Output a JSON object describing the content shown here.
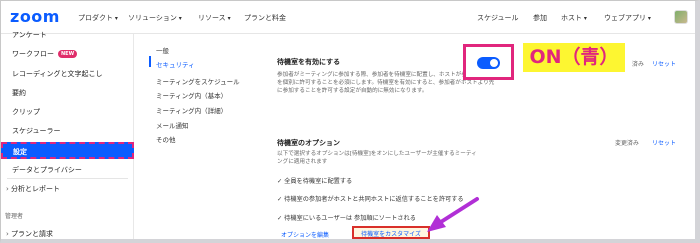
{
  "brand": {
    "logo_text": "zoom",
    "accent": "#0b5cff",
    "annotation_pink": "#e1267d",
    "annotation_yellow": "#fdf631"
  },
  "topnav": {
    "left_items": [
      "プロダクト",
      "ソリューション",
      "リソース",
      "プランと料金"
    ],
    "right_items": [
      "スケジュール",
      "参加",
      "ホスト",
      "ウェブアプリ"
    ]
  },
  "sidebar": {
    "items": [
      {
        "label": "アンケート"
      },
      {
        "label": "ワークフロー",
        "badge": "NEW"
      },
      {
        "label": "レコーディングと文字起こし"
      },
      {
        "label": "要約"
      },
      {
        "label": "クリップ"
      },
      {
        "label": "スケジューラー"
      },
      {
        "label": "設定",
        "active": true
      },
      {
        "label": "データとプライバシー"
      },
      {
        "label": "分析とレポート"
      },
      {
        "label": "管理者"
      },
      {
        "label": "プランと請求"
      }
    ]
  },
  "subnav": {
    "items": [
      "一般",
      "セキュリティ",
      "ミーティングをスケジュール",
      "ミーティング内（基本）",
      "ミーティング内（詳細）",
      "メール通知",
      "その他"
    ],
    "active_index": 1
  },
  "settings": {
    "waiting_room": {
      "title": "待機室を有効にする",
      "description": "参加者がミーティングに参加する際、参加者を待機室に配置し、ホストが参加者の入室を個別に許可することを必須にします。待機室を有効にすると、参加者がホストより先に参加することを許可する設定が自動的に無効になります。",
      "toggle_on": true,
      "locked_label": "済み",
      "reset_label": "リセット"
    },
    "waiting_room_options": {
      "title": "待機室のオプション",
      "description": "以下で選択するオプションは[待機室]をオンにしたユーザーが主催するミーティングに適用されます",
      "options": [
        "全員を待機室に配置する",
        "待機室の参加者がホストと共同ホストに返信することを許可する",
        "待機室にいるユーザーは 参加順にソートされる"
      ],
      "edit_options_label": "オプションを編集",
      "customize_label": "待機室をカスタマイズ",
      "changed_label": "変更済み",
      "reset_label": "リセット"
    }
  },
  "annotation": {
    "label": "ON（青）"
  }
}
